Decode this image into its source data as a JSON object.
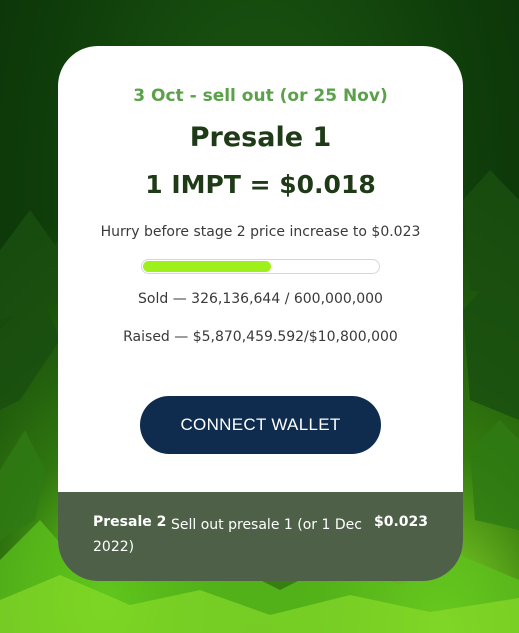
{
  "presale": {
    "date_range": "3 Oct - sell out (or 25 Nov)",
    "title": "Presale 1",
    "price": "1 IMPT = $0.018",
    "hurry_text": "Hurry before stage 2 price increase to $0.023",
    "progress_fraction": 0.5436,
    "sold_text": "Sold — 326,136,644 / 600,000,000",
    "raised_text": "Raised — $5,870,459.592/$10,800,000",
    "connect_label": "CONNECT WALLET"
  },
  "next_stage": {
    "name": "Presale 2",
    "description": "Sell out presale 1 (or 1 Dec 2022)",
    "price": "$0.023"
  },
  "colors": {
    "accent_green": "#5aa14a",
    "progress_fill": "#9ef01a",
    "button_bg": "#0f2c4e",
    "title_text": "#1f3a16"
  }
}
